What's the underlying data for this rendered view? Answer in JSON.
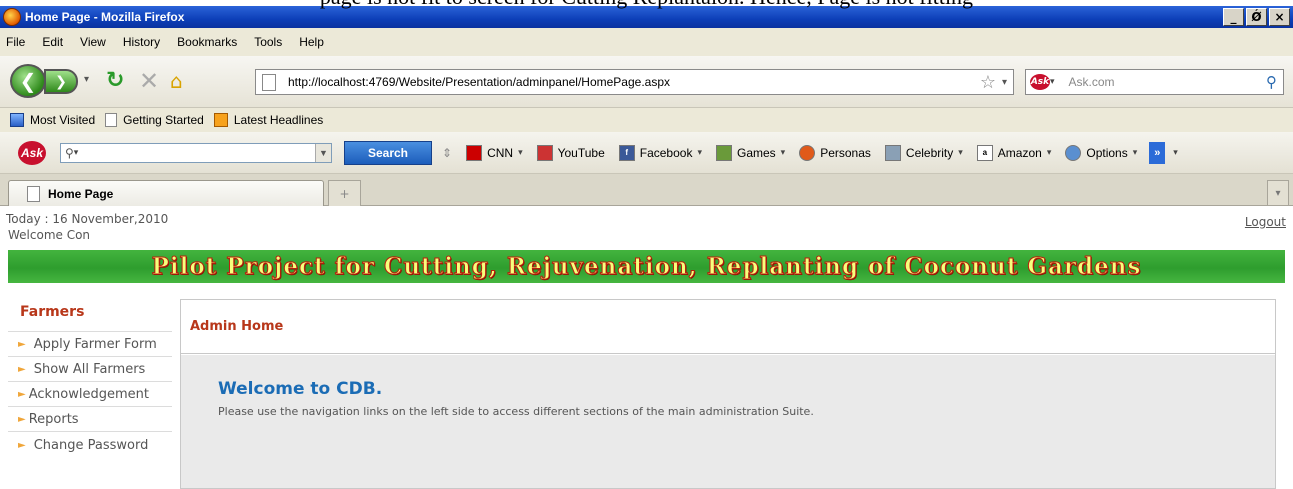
{
  "caption": "page is not fit to screen for Cutting Replantaion. Hence, Page is not fitting",
  "window": {
    "title": "Home Page - Mozilla Firefox",
    "controls": {
      "minimize": "_",
      "restore": "Ǿ",
      "close": "×"
    }
  },
  "menu": [
    "File",
    "Edit",
    "View",
    "History",
    "Bookmarks",
    "Tools",
    "Help"
  ],
  "navbar": {
    "url": "http://localhost:4769/Website/Presentation/adminpanel/HomePage.aspx",
    "search_placeholder": "Ask.com"
  },
  "bookmarks": [
    "Most Visited",
    "Getting Started",
    "Latest Headlines"
  ],
  "ask_toolbar": {
    "search_button": "Search",
    "links": [
      "CNN",
      "YouTube",
      "Facebook",
      "Games",
      "Personas",
      "Celebrity",
      "Amazon",
      "Options"
    ]
  },
  "tab": {
    "label": "Home Page"
  },
  "page": {
    "today": "Today : 16 November,2010",
    "welcome": "Welcome Con",
    "logout": "Logout",
    "banner": "Pilot Project for Cutting, Rejuvenation, Replanting of Coconut Gardens",
    "sidebar": {
      "heading": "Farmers",
      "items": [
        "Apply Farmer Form",
        "Show All Farmers",
        "Acknowledgement",
        "Reports",
        "Change Password"
      ]
    },
    "panel": {
      "header": "Admin Home",
      "title": "Welcome to CDB.",
      "description": "Please use the navigation links on the left side to access different sections of the main administration Suite."
    }
  },
  "colors": {
    "titlebar": "#0d3fb8",
    "banner_green": "#2e9d2e",
    "banner_text": "#f6ff7c",
    "accent_red": "#b8371a",
    "welcome_blue": "#1b6cb5"
  }
}
